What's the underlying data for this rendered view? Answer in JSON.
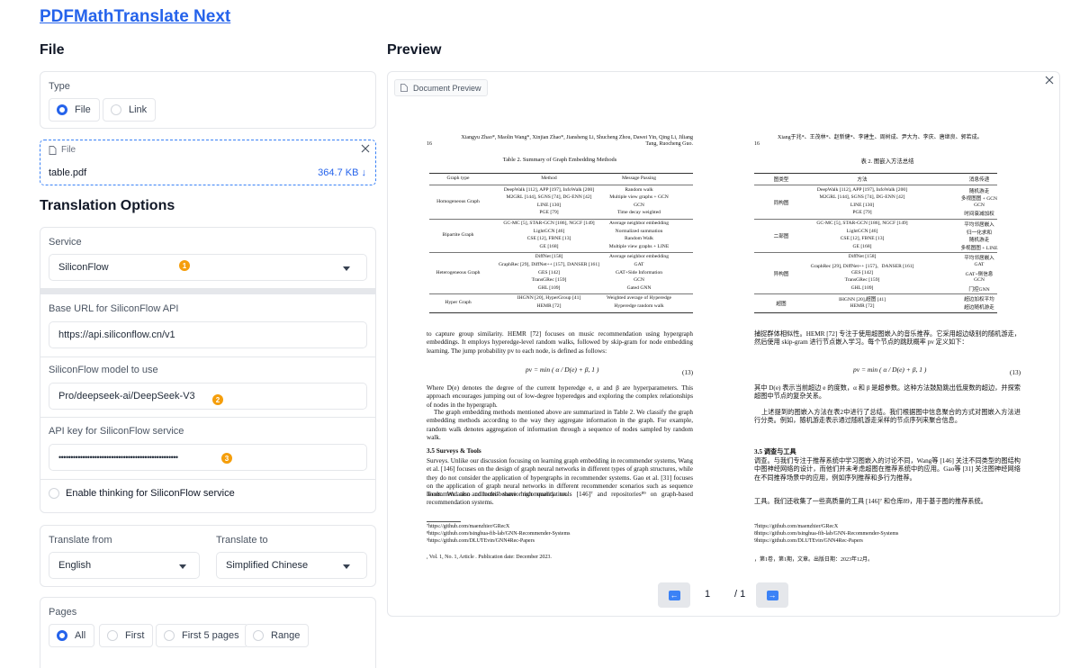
{
  "app": {
    "title": "PDFMathTranslate Next"
  },
  "file_section": {
    "heading": "File",
    "type_label": "Type",
    "type_options": [
      "File",
      "Link"
    ],
    "upload": {
      "label": "File",
      "filename": "table.pdf",
      "size": "364.7 KB ↓"
    }
  },
  "options": {
    "heading": "Translation Options",
    "service": {
      "label": "Service",
      "value": "SiliconFlow",
      "badge": "1"
    },
    "base_url": {
      "label": "Base URL for SiliconFlow API",
      "value": "https://api.siliconflow.cn/v1"
    },
    "model": {
      "label": "SiliconFlow model to use",
      "value": "Pro/deepseek-ai/DeepSeek-V3",
      "badge": "2"
    },
    "api_key": {
      "label": "API key for SiliconFlow service",
      "value": "••••••••••••••••••••••••••••••••••••••••••••••••••",
      "badge": "3"
    },
    "thinking": {
      "label": "Enable thinking for SiliconFlow service"
    },
    "lang_from": {
      "label": "Translate from",
      "value": "English"
    },
    "lang_to": {
      "label": "Translate to",
      "value": "Simplified Chinese"
    },
    "pages": {
      "label": "Pages",
      "options": [
        "All",
        "First",
        "First 5 pages",
        "Range"
      ]
    }
  },
  "preview": {
    "heading": "Preview",
    "tag": "Document Preview",
    "page_input": "1",
    "page_total": "/ 1",
    "left_page": {
      "authors": "Xiangyu Zhao*, Maolin Wang*, Xinjian Zhao*, Jiansheng Li, Shucheng Zhou, Dawei Yin, Qing Li, Jiliang Tang, Ruocheng Guo.",
      "page_no": "16",
      "table_caption": "Table 2.  Summary of Graph Embedding Methods",
      "table_header": [
        "Graph type",
        "Method",
        "Message Passing"
      ],
      "table_groups": [
        {
          "type": "Homogeneous Graph",
          "rows": [
            [
              "DeepWalk [112], APP [197], InfoWalk [200]",
              "Random walk"
            ],
            [
              "M2GRL [144], SGNS [74], DG-ENN [42]",
              "Multiple view graphs + GCN"
            ],
            [
              "LINE [130]",
              "GCN"
            ],
            [
              "PGE [79]",
              "Time decay weighted"
            ]
          ]
        },
        {
          "type": "Bipartite Graph",
          "rows": [
            [
              "GC-MC [5], STAR-GCN [186], NGCF [149]",
              "Average neighbor embedding"
            ],
            [
              "LightGCN [46]",
              "Normalized summation"
            ],
            [
              "CSE [12], FBNE [13]",
              "Random Walk"
            ],
            [
              "GE [168]",
              "Multiple view graphs + LINE"
            ]
          ]
        },
        {
          "type": "Heterogeneous Graph",
          "rows": [
            [
              "DiffNet [158]",
              "Average neighbor embedding"
            ],
            [
              "GraphRec [29], DiffNet++ [157], DANSER [161]",
              "GAT"
            ],
            [
              "GES [142]",
              "GAT+Side Information"
            ],
            [
              "TransGRec [159]",
              "GCN"
            ],
            [
              "GHL [109]",
              "Gated GNN"
            ]
          ]
        },
        {
          "type": "Hyper Graph",
          "rows": [
            [
              "IHGNN [20], HyperGroup [41]",
              "Weighted average of Hyperedge"
            ],
            [
              "HEMR [72]",
              "Hyperedge random walk"
            ]
          ]
        }
      ],
      "para1": "to capture group similarity. HEMR [72] focuses on music recommendation using hypergraph embeddings. It employs hyperedge-level random walks, followed by skip-gram for node embedding learning. The jump probability pv to each node, is defined as follows:",
      "equation": "pv = min ( α / D(e) + β, 1 )",
      "eq_no": "(13)",
      "para2": "Where D(e) denotes the degree of the current hyperedge e, α and β are hyperparameters. This approach encourages jumping out of low-degree hyperedges and exploring the complex relationships of nodes in the hypergraph.",
      "para3": "The graph embedding methods mentioned above are summarized in Table 2. We classify the graph embedding methods according to the way they aggregate information in the graph. For example, random walk denotes aggregation of information through a sequence of nodes sampled by random walk.",
      "section": "3.5   Surveys & Tools",
      "para4": "Surveys. Unlike our discussion focusing on learning graph embedding in recommender systems, Wang et al. [146] focuses on the design of graph neural networks in different types of graph structures, while they do not consider the application of hypergraphs in recommender systems. Gao et al. [31] focuses on the application of graph neural networks in different recommender scenarios such as sequence recommendation and multi-behavior recommendation.",
      "para5": "Tools. We also collected some high quality tools [146]⁷ and repositories⁸⁹ on graph-based recommendation systems.",
      "footnotes": [
        "⁷https://github.com/maenzhier/GRecX",
        "⁸https://github.com/tsinghua-fib-lab/GNN-Recommender-Systems",
        "⁹https://github.com/DLUTEvin/GNN4Rec-Papers"
      ],
      "footer": ", Vol. 1, No. 1, Article . Publication date: December 2023."
    },
    "right_page": {
      "authors": "Xiang于兆*、王茂林*、赵新健*、李建生、周树成、尹大为、李庆、唐继良、郭若成。",
      "page_no": "16",
      "table_caption": "表 2. 图嵌入方法总结",
      "table_header": [
        "图类型",
        "方法",
        "消息传递"
      ],
      "table_groups": [
        {
          "type": "同构图",
          "rows": [
            [
              "DeepWalk [112], APP [197], InfoWalk [200]",
              "随机游走"
            ],
            [
              "M2GRL [144], SGNS [74], DG-ENN [42]",
              "多视图图 + GCN"
            ],
            [
              "LINE [130]",
              "GCN"
            ],
            [
              "PGE [79]",
              "时间衰减加权"
            ]
          ]
        },
        {
          "type": "二部图",
          "rows": [
            [
              "GC-MC [5], STAR-GCN [186], NGCF [149]",
              "平均邻居嵌入"
            ],
            [
              "LightGCN [46]",
              "归一化求和"
            ],
            [
              "CSE [12], FBNE [13]",
              "随机游走"
            ],
            [
              "GE [168]",
              "多视图图 + LINE"
            ]
          ]
        },
        {
          "type": "异构图",
          "rows": [
            [
              "DiffNet [158]",
              "平均邻居嵌入"
            ],
            [
              "GraphRec [29], DiffNet++ [157]、DANSER [161]",
              "GAT"
            ],
            [
              "GES [142]",
              "GAT+侧信息"
            ],
            [
              "TransGRec [159]",
              "GCN"
            ],
            [
              "GHL [109]",
              "门控GNN"
            ]
          ]
        },
        {
          "type": "超图",
          "rows": [
            [
              "IHGNN [20],超图 [41]",
              "超边加权平均"
            ],
            [
              "HEMR [72]",
              "超边随机游走"
            ]
          ]
        }
      ],
      "para1": "捕捉群体相似性。HEMR [72] 专注于使用超图嵌入的音乐推荐。它采用超边级别的随机游走，然后使用 skip-gram 进行节点嵌入学习。每个节点的跳跃概率 pv 定义如下：",
      "equation": "pv = min ( α / D(e) + β, 1 )",
      "eq_no": "(13)",
      "para2": "其中 D(e) 表示当前超边 e 的度数，α 和 β 是超参数。这种方法鼓励跳出低度数的超边，并探索超图中节点的复杂关系。",
      "para3": "上述提到的图嵌入方法在表2中进行了总结。我们根据图中信息聚合的方式对图嵌入方法进行分类。例如，随机游走表示通过随机游走采样的节点序列来聚合信息。",
      "section": "3.5 调查与工具",
      "para4": "调查。与我们专注于推荐系统中学习图嵌入的讨论不同，Wang等 [146] 关注不同类型的图结构中图神经网络的设计，而他们并未考虑超图在推荐系统中的应用。Gao等 [31] 关注图神经网络在不同推荐场景中的应用，例如序列推荐和多行为推荐。",
      "para5": "工具。我们还收集了一些高质量的工具 [146]⁷ 和仓库89，用于基于图的推荐系统。",
      "footnotes": [
        "7https://github.com/maenzhier/GRecX",
        "8https://github.com/tsinghua-fib-lab/GNN-Recommender-Systems",
        "9https://github.com/DLUTEvin/GNN4Rec-Papers"
      ],
      "footer": "，第1卷，第1期，文章。出版日期：2023年12月。"
    }
  }
}
